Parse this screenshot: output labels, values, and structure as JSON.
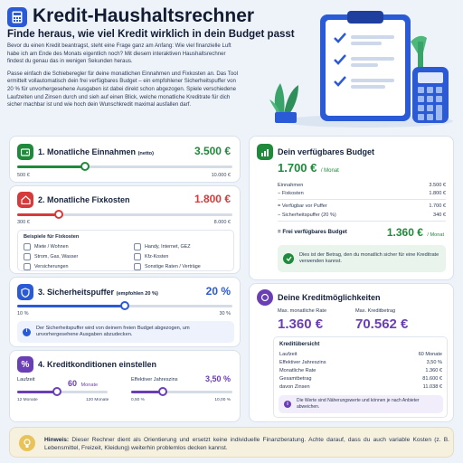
{
  "header": {
    "title": "Kredit-Haushaltsrechner",
    "subtitle": "Finde heraus, wie viel Kredit wirklich in dein Budget passt",
    "intro_1": "Bevor du einen Kredit beantragst, steht eine Frage ganz am Anfang: Wie viel finanzielle Luft habe ich am Ende des Monats eigentlich noch? Mit diesem interaktiven Haushaltsrechner findest du genau das in wenigen Sekunden heraus.",
    "intro_2": "Passe einfach die Schieberegler für deine monatlichen Einnahmen und Fixkosten an. Das Tool ermittelt vollautomatisch dein frei verfügbares Budget – ein empfohlener Sicherheitspuffer von 20 % für unvorhergesehene Ausgaben ist dabei direkt schon abgezogen. Spiele verschiedene Laufzeiten und Zinsen durch und sieh auf einen Blick, welche monatliche Kreditrate für dich sicher machbar ist und wie hoch dein Wunschkredit maximal ausfallen darf."
  },
  "income": {
    "number": "1.",
    "label": "Monatliche Einnahmen",
    "suffix": "(netto)",
    "value": "3.500 €",
    "min": "500 €",
    "max": "10.000 €",
    "fraction": 0.316
  },
  "fixed": {
    "number": "2.",
    "label": "Monatliche Fixkosten",
    "value": "1.800 €",
    "min": "300 €",
    "max": "8.000 €",
    "fraction": 0.195,
    "cats_title": "Beispiele für Fixkosten",
    "cats": [
      "Miete / Wohnen",
      "Handy, Internet, GEZ",
      "Strom, Gas, Wasser",
      "Kfz-Kosten",
      "Versicherungen",
      "Sonstige Raten / Verträge"
    ]
  },
  "buffer": {
    "number": "3.",
    "label": "Sicherheitspuffer",
    "suffix": "(empfohlen 20 %)",
    "value": "20 %",
    "min": "10 %",
    "max": "30 %",
    "fraction": 0.5,
    "info": "Der Sicherheitspuffer wird von deinem freien Budget abgezogen, um unvorhergesehene Ausgaben abzudecken."
  },
  "credit": {
    "number": "4.",
    "label": "Kreditkonditionen einstellen",
    "term_label": "Laufzeit",
    "term_value": "60",
    "term_unit": "Monate",
    "term_min": "12 Monate",
    "term_max": "120 Monate",
    "term_fraction": 0.444,
    "rate_label": "Effektiver Jahreszins",
    "rate_value": "3,50 %",
    "rate_min": "0,50 %",
    "rate_max": "10,00 %",
    "rate_fraction": 0.316
  },
  "budget": {
    "title": "Dein verfügbares Budget",
    "value": "1.700 €",
    "unit": "/ Monat",
    "rows": [
      {
        "label": "Einnahmen",
        "value": "3.500 €"
      },
      {
        "label": "− Fixkosten",
        "value": "1.800 €"
      },
      {
        "label": "= Verfügbar vor Puffer",
        "value": "1.700 €"
      },
      {
        "label": "− Sicherheitspuffer (20 %)",
        "value": "340 €"
      }
    ],
    "free_label": "= Frei verfügbares Budget",
    "free_value": "1.360 €",
    "free_unit": "/ Monat",
    "info": "Dies ist der Betrag, den du monatlich sicher für eine Kreditrate verwenden kannst."
  },
  "possibilities": {
    "title": "Deine Kreditmöglichkeiten",
    "rate_label": "Max. monatliche Rate",
    "rate_value": "1.360 €",
    "amount_label": "Max. Kreditbetrag",
    "amount_value": "70.562 €",
    "overview_title": "Kreditübersicht",
    "rows": [
      {
        "label": "Laufzeit",
        "value": "60 Monate"
      },
      {
        "label": "Effektiver Jahreszins",
        "value": "3,50 %"
      },
      {
        "label": "Monatliche Rate",
        "value": "1.360 €"
      },
      {
        "label": "Gesamtbetrag",
        "value": "81.600 €"
      },
      {
        "label": "davon Zinsen",
        "value": "11.038 €"
      }
    ],
    "note": "Die Werte sind Näherungswerte und können je nach Anbieter abweichen."
  },
  "hint": {
    "label": "Hinweis:",
    "text": "Dieser Rechner dient als Orientierung und ersetzt keine individuelle Finanzberatung. Achte darauf, dass du auch variable Kosten (z. B. Lebensmittel, Freizeit, Kleidung) weiterhin problemlos decken kannst."
  },
  "colors": {
    "green": "#1f8a3b",
    "red": "#d63a3a",
    "blue": "#2b5ad6",
    "purple": "#6a3fb5"
  },
  "icons": [
    "calculator-icon",
    "wallet-icon",
    "house-icon",
    "shield-icon",
    "percent-icon",
    "chart-icon",
    "check-shield-icon",
    "info-icon",
    "coins-icon",
    "lightbulb-icon"
  ]
}
